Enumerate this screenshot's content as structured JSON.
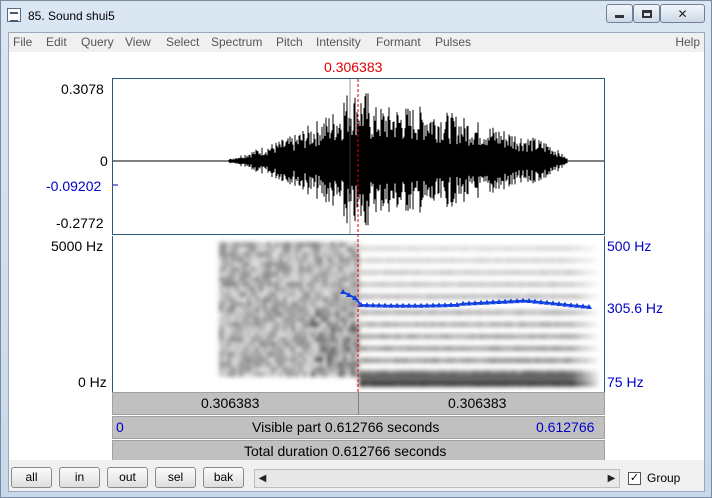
{
  "window": {
    "title": "85. Sound shui5"
  },
  "menu": [
    "File",
    "Edit",
    "Query",
    "View",
    "Select",
    "Spectrum",
    "Pitch",
    "Intensity",
    "Formant",
    "Pulses"
  ],
  "help": "Help",
  "cursor_time": "0.306383",
  "waveform": {
    "y_max": "0.3078",
    "y_zero": "0",
    "y_cursor": "-0.09202",
    "y_min": "-0.2772"
  },
  "spectrogram": {
    "freq_top": "5000 Hz",
    "freq_bottom": "0 Hz",
    "pitch_top": "500 Hz",
    "pitch_value": "305.6 Hz",
    "pitch_bottom": "75 Hz"
  },
  "time_bars": {
    "left_segment": "0.306383",
    "right_segment": "0.306383",
    "visible_start": "0",
    "visible_label": "Visible part 0.612766 seconds",
    "visible_end": "0.612766",
    "total_label": "Total duration 0.612766 seconds"
  },
  "buttons": {
    "all": "all",
    "in": "in",
    "out": "out",
    "sel": "sel",
    "bak": "bak"
  },
  "group": {
    "label": "Group",
    "checked": "✓"
  },
  "colors": {
    "cursor": "#e00000",
    "pitch": "#1040e0",
    "axis_blue": "#0000c8"
  }
}
